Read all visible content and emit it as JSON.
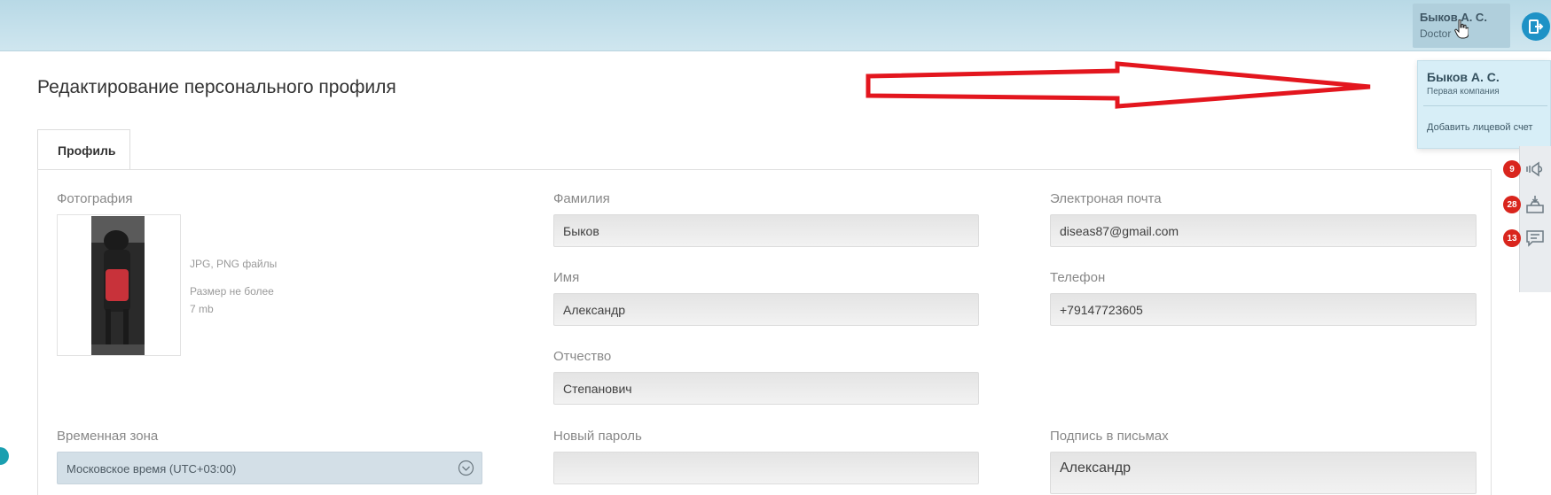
{
  "header": {
    "user_name": "Быков А. С.",
    "user_role": "Doctor"
  },
  "dropdown": {
    "name": "Быков А. С.",
    "company": "Первая компания",
    "add_account": "Добавить лицевой счет"
  },
  "page": {
    "title": "Редактирование персонального профиля",
    "tab_profile": "Профиль"
  },
  "photo": {
    "label": "Фотография",
    "hint_formats": "JPG, PNG файлы",
    "hint_size_line1": "Размер не более",
    "hint_size_line2": "7 mb"
  },
  "form": {
    "surname_label": "Фамилия",
    "surname_value": "Быков",
    "name_label": "Имя",
    "name_value": "Александр",
    "patronymic_label": "Отчество",
    "patronymic_value": "Степанович",
    "email_label": "Электроная почта",
    "email_value": "diseas87@gmail.com",
    "phone_label": "Телефон",
    "phone_value": "+79147723605",
    "timezone_label": "Временная зона",
    "timezone_value": "Московское время (UTC+03:00)",
    "password_label": "Новый пароль",
    "password_value": "",
    "signature_label": "Подпись в письмах",
    "signature_value": "Александр"
  },
  "side": {
    "badge_1": "9",
    "badge_2": "28",
    "badge_3": "13"
  },
  "colors": {
    "topbar": "#c4e1ec",
    "accent": "#1e92c6",
    "badge": "#d9251d",
    "arrow": "#e3161e"
  }
}
